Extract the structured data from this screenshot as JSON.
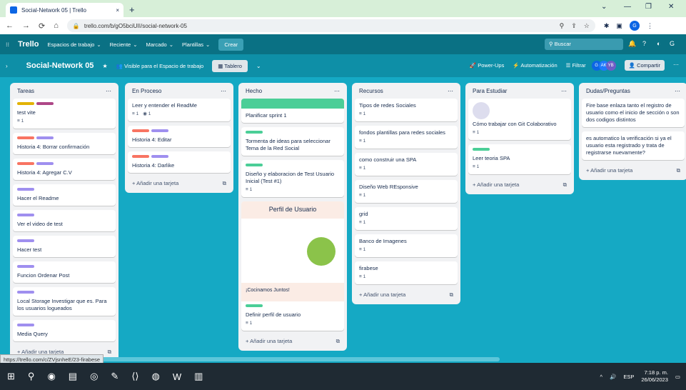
{
  "browser": {
    "tab_title": "Social-Network 05 | Trello",
    "url": "trello.com/b/gO5bciUII/social-network-05"
  },
  "trello": {
    "logo": "Trello",
    "menus": [
      "Espacios de trabajo",
      "Reciente",
      "Marcado",
      "Plantillas"
    ],
    "create": "Crear",
    "search_placeholder": "Buscar"
  },
  "board": {
    "name": "Social-Network 05",
    "visibility": "Visible para el Espacio de trabajo",
    "view": "Tablero",
    "powerups": "Power-Ups",
    "automation": "Automatización",
    "filter": "Filtrar",
    "share": "Compartir",
    "avatars": [
      "AK",
      "YB"
    ]
  },
  "lists": [
    {
      "title": "Tareas",
      "cards": [
        {
          "labels": [
            "#e2b203",
            "#ae4787"
          ],
          "title": "test vite",
          "meta": [
            "1"
          ]
        },
        {
          "labels": [
            "#f87462",
            "#9f8fef"
          ],
          "title": "Historia 4: Borrar confirmación"
        },
        {
          "labels": [
            "#f87462",
            "#9f8fef"
          ],
          "title": "Historia 4: Agregar C.V"
        },
        {
          "labels": [
            "#9f8fef"
          ],
          "title": "Hacer el Readme"
        },
        {
          "labels": [
            "#9f8fef"
          ],
          "title": "Ver el video de test"
        },
        {
          "labels": [
            "#9f8fef"
          ],
          "title": "Hacer test"
        },
        {
          "labels": [
            "#9f8fef"
          ],
          "title": "Funcion Ordenar Post"
        },
        {
          "labels": [
            "#9f8fef"
          ],
          "title": "Local Storage Investigar que es. Para los usuarios logueados"
        },
        {
          "labels": [
            "#9f8fef"
          ],
          "title": "Media Query"
        }
      ],
      "add": "Añadir una tarjeta"
    },
    {
      "title": "En Proceso",
      "cards": [
        {
          "labels": [],
          "title": "Leer y entender el ReadMe",
          "meta": [
            "1",
            "1"
          ]
        },
        {
          "labels": [
            "#f87462",
            "#9f8fef"
          ],
          "title": "Historia 4: Editar"
        },
        {
          "labels": [
            "#f87462",
            "#9f8fef"
          ],
          "title": "Historia 4: Darlike"
        }
      ],
      "add": "Añadir una tarjeta"
    },
    {
      "title": "Hecho",
      "cards": [
        {
          "cover": true,
          "labels": [],
          "title": "Planificar sprint 1"
        },
        {
          "labels": [
            "#4bce97"
          ],
          "title": "Tormenta de ideas para seleccionar Tema de la Red Social"
        },
        {
          "labels": [
            "#4bce97"
          ],
          "title": "Diseño y elaboracion de Test Usuario Inicial (Test #1)",
          "meta": [
            "1"
          ]
        },
        {
          "image": {
            "title": "Perfil de Usuario",
            "footer": "¡Cocinamos Juntos!"
          },
          "labels": [
            "#4bce97"
          ],
          "title": "Definir perfil de usuario",
          "meta": [
            "1"
          ]
        }
      ],
      "add": "Añadir una tarjeta"
    },
    {
      "title": "Recursos",
      "cards": [
        {
          "title": "Tipos de redes Sociales",
          "meta": [
            "1"
          ]
        },
        {
          "title": "fondos plantillas para redes sociales",
          "meta": [
            "1"
          ]
        },
        {
          "title": "como construir una SPA",
          "meta": [
            "1"
          ]
        },
        {
          "title": "Diseño Web REsponsive",
          "meta": [
            "1"
          ]
        },
        {
          "title": "grid",
          "meta": [
            "1"
          ]
        },
        {
          "title": "Banco de Imagenes",
          "meta": [
            "1"
          ]
        },
        {
          "title": "firabese",
          "meta": [
            "1"
          ]
        }
      ],
      "add": "Añadir una tarjeta"
    },
    {
      "title": "Para Estudiar",
      "cards": [
        {
          "dog": true,
          "title": "Cómo trabajar con Git Colaborativo",
          "meta": [
            "1"
          ]
        },
        {
          "labels": [
            "#4bce97"
          ],
          "title": "Leer teoria SPA",
          "meta": [
            "1"
          ]
        }
      ],
      "add": "Añadir una tarjeta"
    },
    {
      "title": "Dudas/Preguntas",
      "cards": [
        {
          "title": "Fire base enlaza tanto el registro de usuario como el inicio de sección o son dos codigos distintos"
        },
        {
          "title": "es automatico la verificación si ya el usuario esta registrado y trata de registrarse nuevamente?"
        }
      ],
      "add": "Añadir una tarjeta"
    }
  ],
  "status_url": "https://trello.com/c/ZVjsnheE/23-firabese",
  "taskbar": {
    "lang": "ESP",
    "time": "7:18 p. m.",
    "date": "26/06/2023"
  }
}
